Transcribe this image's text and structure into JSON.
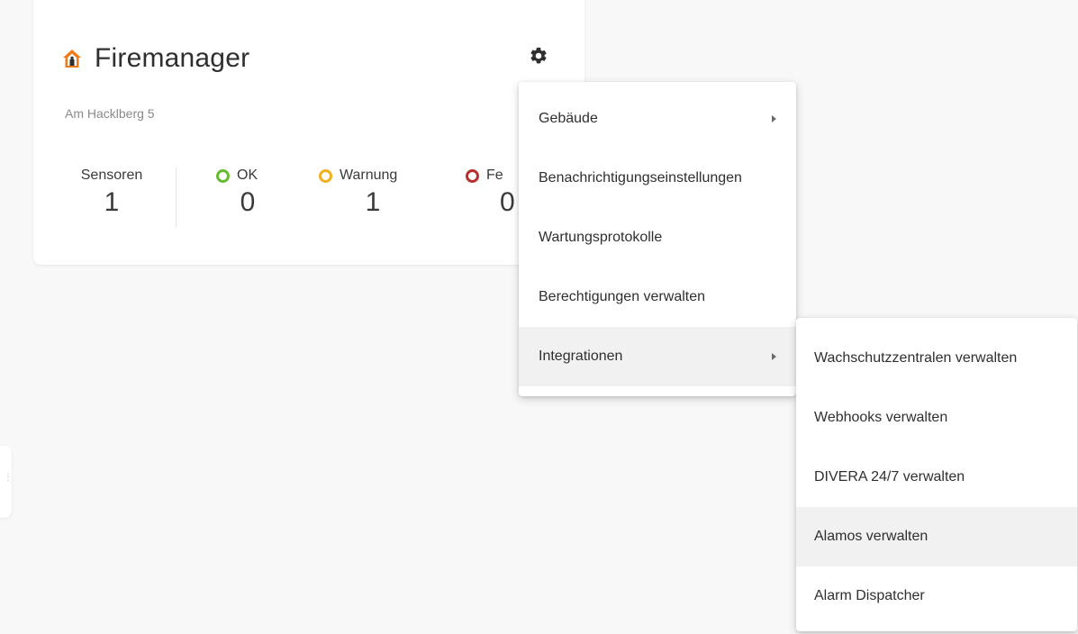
{
  "card": {
    "title": "Firemanager",
    "address": "Am Hacklberg 5",
    "icons": {
      "home": "home-icon",
      "settings": "gear-icon"
    },
    "stats": {
      "sensors": {
        "label": "Sensoren",
        "value": "1"
      },
      "ok": {
        "label": "OK",
        "value": "0",
        "color": "#66bb2e"
      },
      "warning": {
        "label": "Warnung",
        "value": "1",
        "color": "#f0b020"
      },
      "error": {
        "label": "Fe",
        "value": "0",
        "color": "#b82e2e"
      }
    }
  },
  "menu": {
    "items": [
      {
        "label": "Gebäude",
        "has_submenu": true
      },
      {
        "label": "Benachrichtigungseinstellungen"
      },
      {
        "label": "Wartungsprotokolle"
      },
      {
        "label": "Berechtigungen verwalten"
      },
      {
        "label": "Integrationen",
        "has_submenu": true,
        "active": true
      }
    ]
  },
  "submenu": {
    "items": [
      {
        "label": "Wachschutzzentralen verwalten"
      },
      {
        "label": "Webhooks verwalten"
      },
      {
        "label": "DIVERA 24/7 verwalten"
      },
      {
        "label": "Alamos verwalten",
        "hovered": true
      },
      {
        "label": "Alarm Dispatcher"
      }
    ]
  }
}
